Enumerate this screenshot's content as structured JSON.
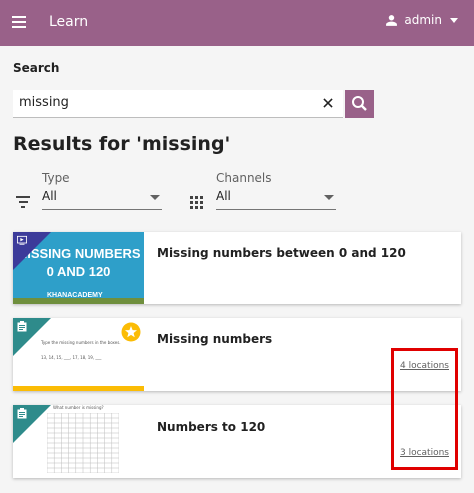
{
  "appbar": {
    "title": "Learn",
    "user": "admin",
    "color": "#996189"
  },
  "search": {
    "label": "Search",
    "value": "missing",
    "placeholder": ""
  },
  "results": {
    "title": "Results for 'missing'"
  },
  "filters": {
    "type": {
      "label": "Type",
      "value": "All"
    },
    "channels": {
      "label": "Channels",
      "value": "All"
    }
  },
  "cards": [
    {
      "title": "Missing numbers between 0 and 120",
      "thumb_line1": "MISSING NUMBERS",
      "thumb_line2": "0 AND 120",
      "thumb_brand": "KHANACADEMY",
      "kind": "video"
    },
    {
      "title": "Missing numbers",
      "locations": "4 locations",
      "thumb_text": "Type the missing numbers in the boxes.",
      "thumb_seq": "13, 14, 15, ___, 17, 18, 19, ___",
      "kind": "exercise"
    },
    {
      "title": "Numbers to 120",
      "locations": "3 locations",
      "thumb_text": "What number is missing?",
      "kind": "exercise"
    }
  ],
  "colors": {
    "brand": "#996189",
    "accent_red": "#e00000",
    "exercise": "#2e8b8b",
    "video": "#3c3b9a",
    "mastery_bar": "#fbbc05"
  },
  "icons": [
    "menu-icon",
    "person-icon",
    "clear-icon",
    "search-icon",
    "filter-icon",
    "grid-icon",
    "video-icon",
    "exercise-icon",
    "star-icon"
  ]
}
